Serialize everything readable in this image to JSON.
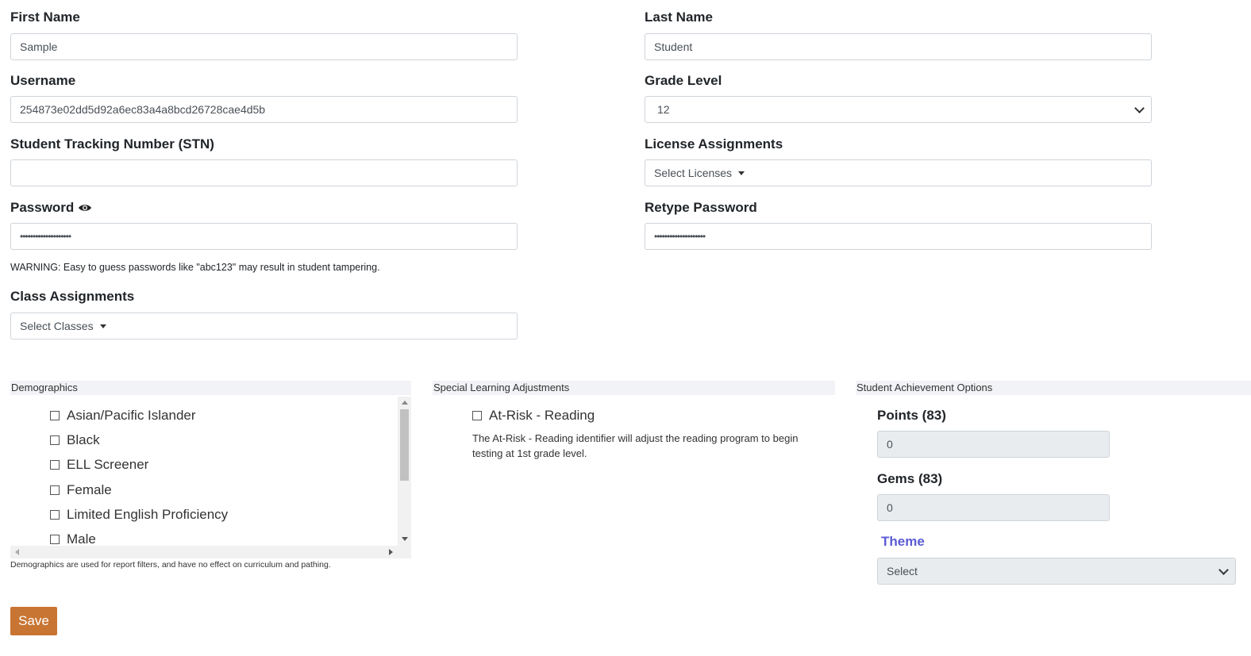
{
  "fields": {
    "first_name": {
      "label": "First Name",
      "value": "Sample"
    },
    "last_name": {
      "label": "Last Name",
      "value": "Student"
    },
    "username": {
      "label": "Username",
      "value": "254873e02dd5d92a6ec83a4a8bcd26728cae4d5b"
    },
    "grade_level": {
      "label": "Grade Level",
      "value": "12"
    },
    "stn": {
      "label": "Student Tracking Number (STN)",
      "value": ""
    },
    "licenses": {
      "label": "License Assignments",
      "value": "Select Licenses"
    },
    "password": {
      "label": "Password",
      "icon": "eye-icon",
      "value": "••••••••••••••••••••"
    },
    "retype_password": {
      "label": "Retype Password",
      "value": "••••••••••••••••••••"
    },
    "password_warning": "WARNING: Easy to guess passwords like \"abc123\" may result in student tampering.",
    "classes": {
      "label": "Class Assignments",
      "value": "Select Classes"
    }
  },
  "demographics": {
    "title": "Demographics",
    "items": [
      "Asian/Pacific Islander",
      "Black",
      "ELL Screener",
      "Female",
      "Limited English Proficiency",
      "Male"
    ],
    "note": "Demographics are used for report filters, and have no effect on curriculum and pathing."
  },
  "special": {
    "title": "Special Learning Adjustments",
    "item": "At-Risk - Reading",
    "description": "The At-Risk - Reading identifier will adjust the reading program to begin testing at 1st grade level."
  },
  "achievement": {
    "title": "Student Achievement Options",
    "points_label": "Points (83)",
    "points_value": "0",
    "gems_label": "Gems (83)",
    "gems_value": "0",
    "theme_label": "Theme",
    "theme_value": "Select",
    "theme_color": "#5b5bd6"
  },
  "save_label": "Save",
  "colors": {
    "save": "#c87533",
    "section_bg": "#f1f3f6"
  }
}
